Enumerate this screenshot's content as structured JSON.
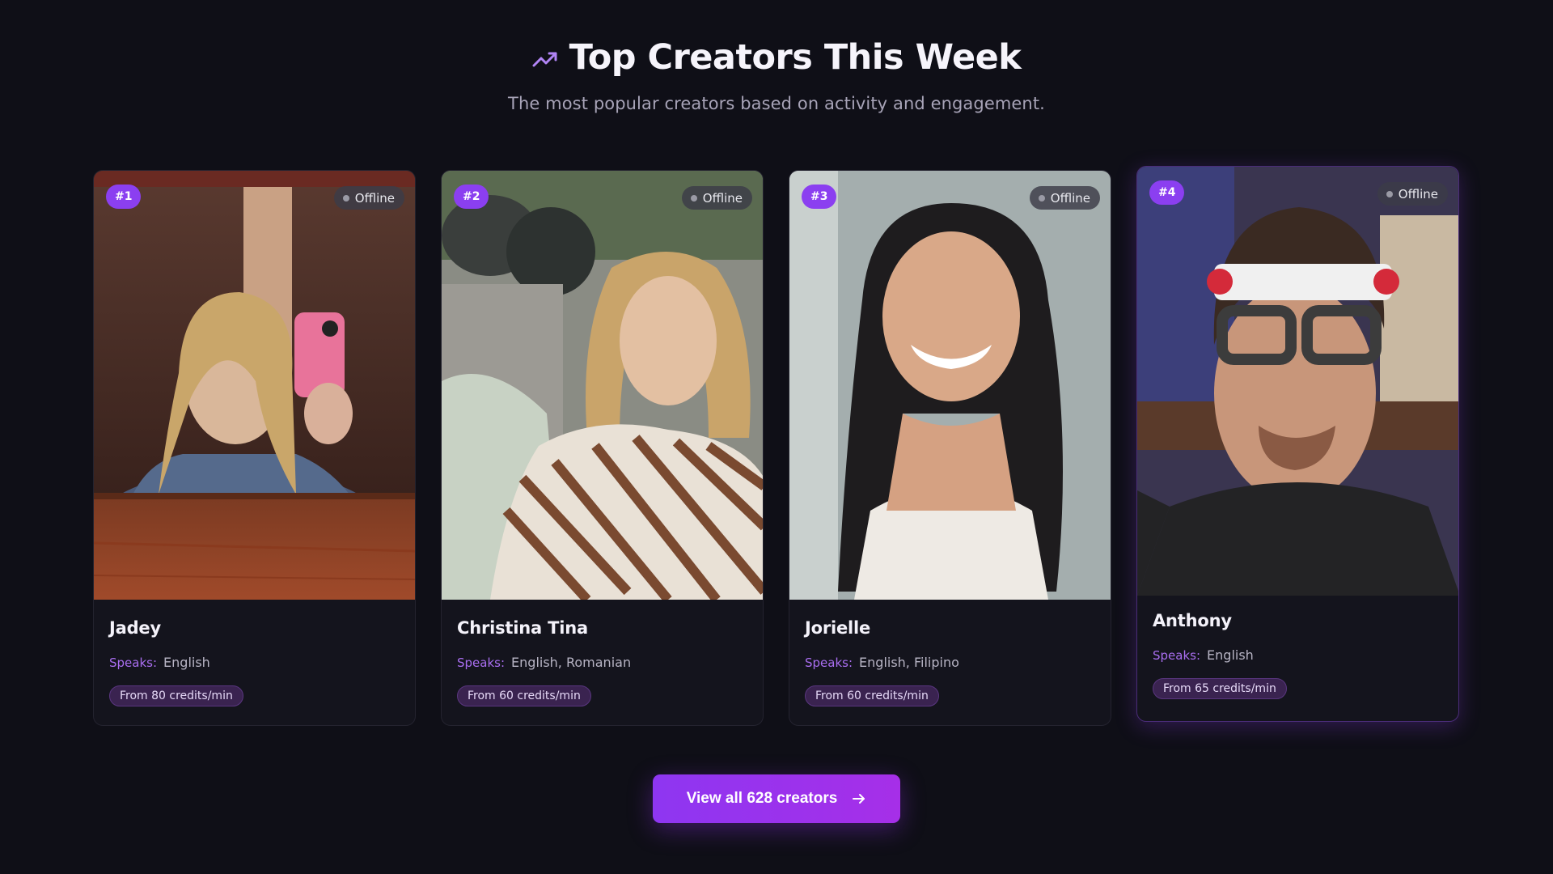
{
  "header": {
    "icon": "trending-up-icon",
    "title": "Top Creators This Week",
    "subtitle": "The most popular creators based on activity and engagement."
  },
  "creators": [
    {
      "rank": "#1",
      "status": "Offline",
      "name": "Jadey",
      "speaks_label": "Speaks:",
      "languages": "English",
      "price": "From 80 credits/min"
    },
    {
      "rank": "#2",
      "status": "Offline",
      "name": "Christina Tina",
      "speaks_label": "Speaks:",
      "languages": "English, Romanian",
      "price": "From 60 credits/min"
    },
    {
      "rank": "#3",
      "status": "Offline",
      "name": "Jorielle",
      "speaks_label": "Speaks:",
      "languages": "English, Filipino",
      "price": "From 60 credits/min"
    },
    {
      "rank": "#4",
      "status": "Offline",
      "name": "Anthony",
      "speaks_label": "Speaks:",
      "languages": "English",
      "price": "From 65 credits/min"
    }
  ],
  "cta": {
    "label": "View all 628 creators",
    "icon": "arrow-right-icon"
  },
  "colors": {
    "background": "#0f0f17",
    "accent": "#8b3ff0",
    "card": "#14141d"
  }
}
